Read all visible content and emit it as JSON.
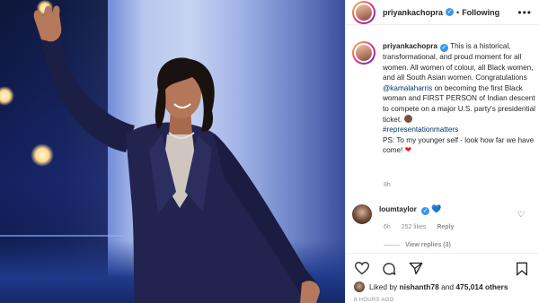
{
  "post": {
    "username": "priyankachopra",
    "follow_state": "Following",
    "separator": "•",
    "more_icon": "more-dots-icon"
  },
  "caption": {
    "username": "priyankachopra",
    "text_1": " This is a historical, transformational, and proud moment for all women. All women of colour, all Black women, and all South Asian women. Congratulations ",
    "mention": "@kamalaharris",
    "text_2": " on becoming the first Black woman and FIRST PERSON of Indian descent to compete on a major U.S. party's presidential ticket. ",
    "hashtag": "#representationmatters",
    "text_3": "PS: To my younger self - look how far we have come! ",
    "time": "8h"
  },
  "comment": {
    "username": "loumtaylor",
    "time": "6h",
    "likes": "252 likes",
    "reply_label": "Reply",
    "view_replies": "View replies (3)"
  },
  "likes": {
    "prefix": "Liked by ",
    "user": "nishanth78",
    "middle": " and ",
    "others": "475,014 others"
  },
  "timestamp": "8 HOURS AGO",
  "colors": {
    "accent_blue": "#3897f0",
    "link": "#00376b",
    "heart_red": "#ed1c24"
  }
}
